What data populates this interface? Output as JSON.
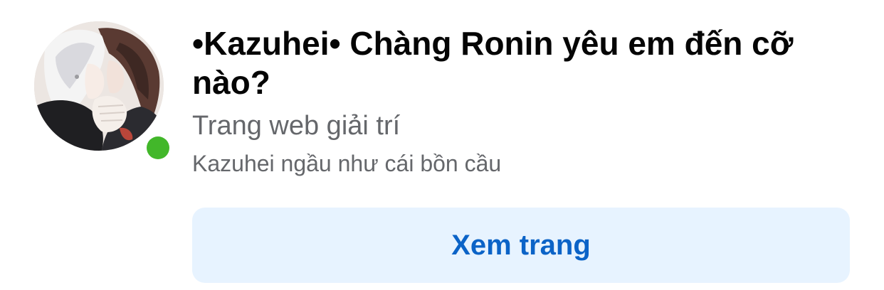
{
  "page": {
    "title": "•Kazuhei• Chàng Ronin yêu em đến cỡ nào?",
    "category": "Trang web giải trí",
    "description": "Kazuhei ngầu như cái bồn cầu",
    "online": true
  },
  "actions": {
    "view_page_label": "Xem trang"
  },
  "colors": {
    "title": "#050505",
    "secondary_text": "#65676b",
    "button_bg": "#e7f3ff",
    "button_text": "#0b63c7",
    "online_dot": "#42b72a"
  }
}
